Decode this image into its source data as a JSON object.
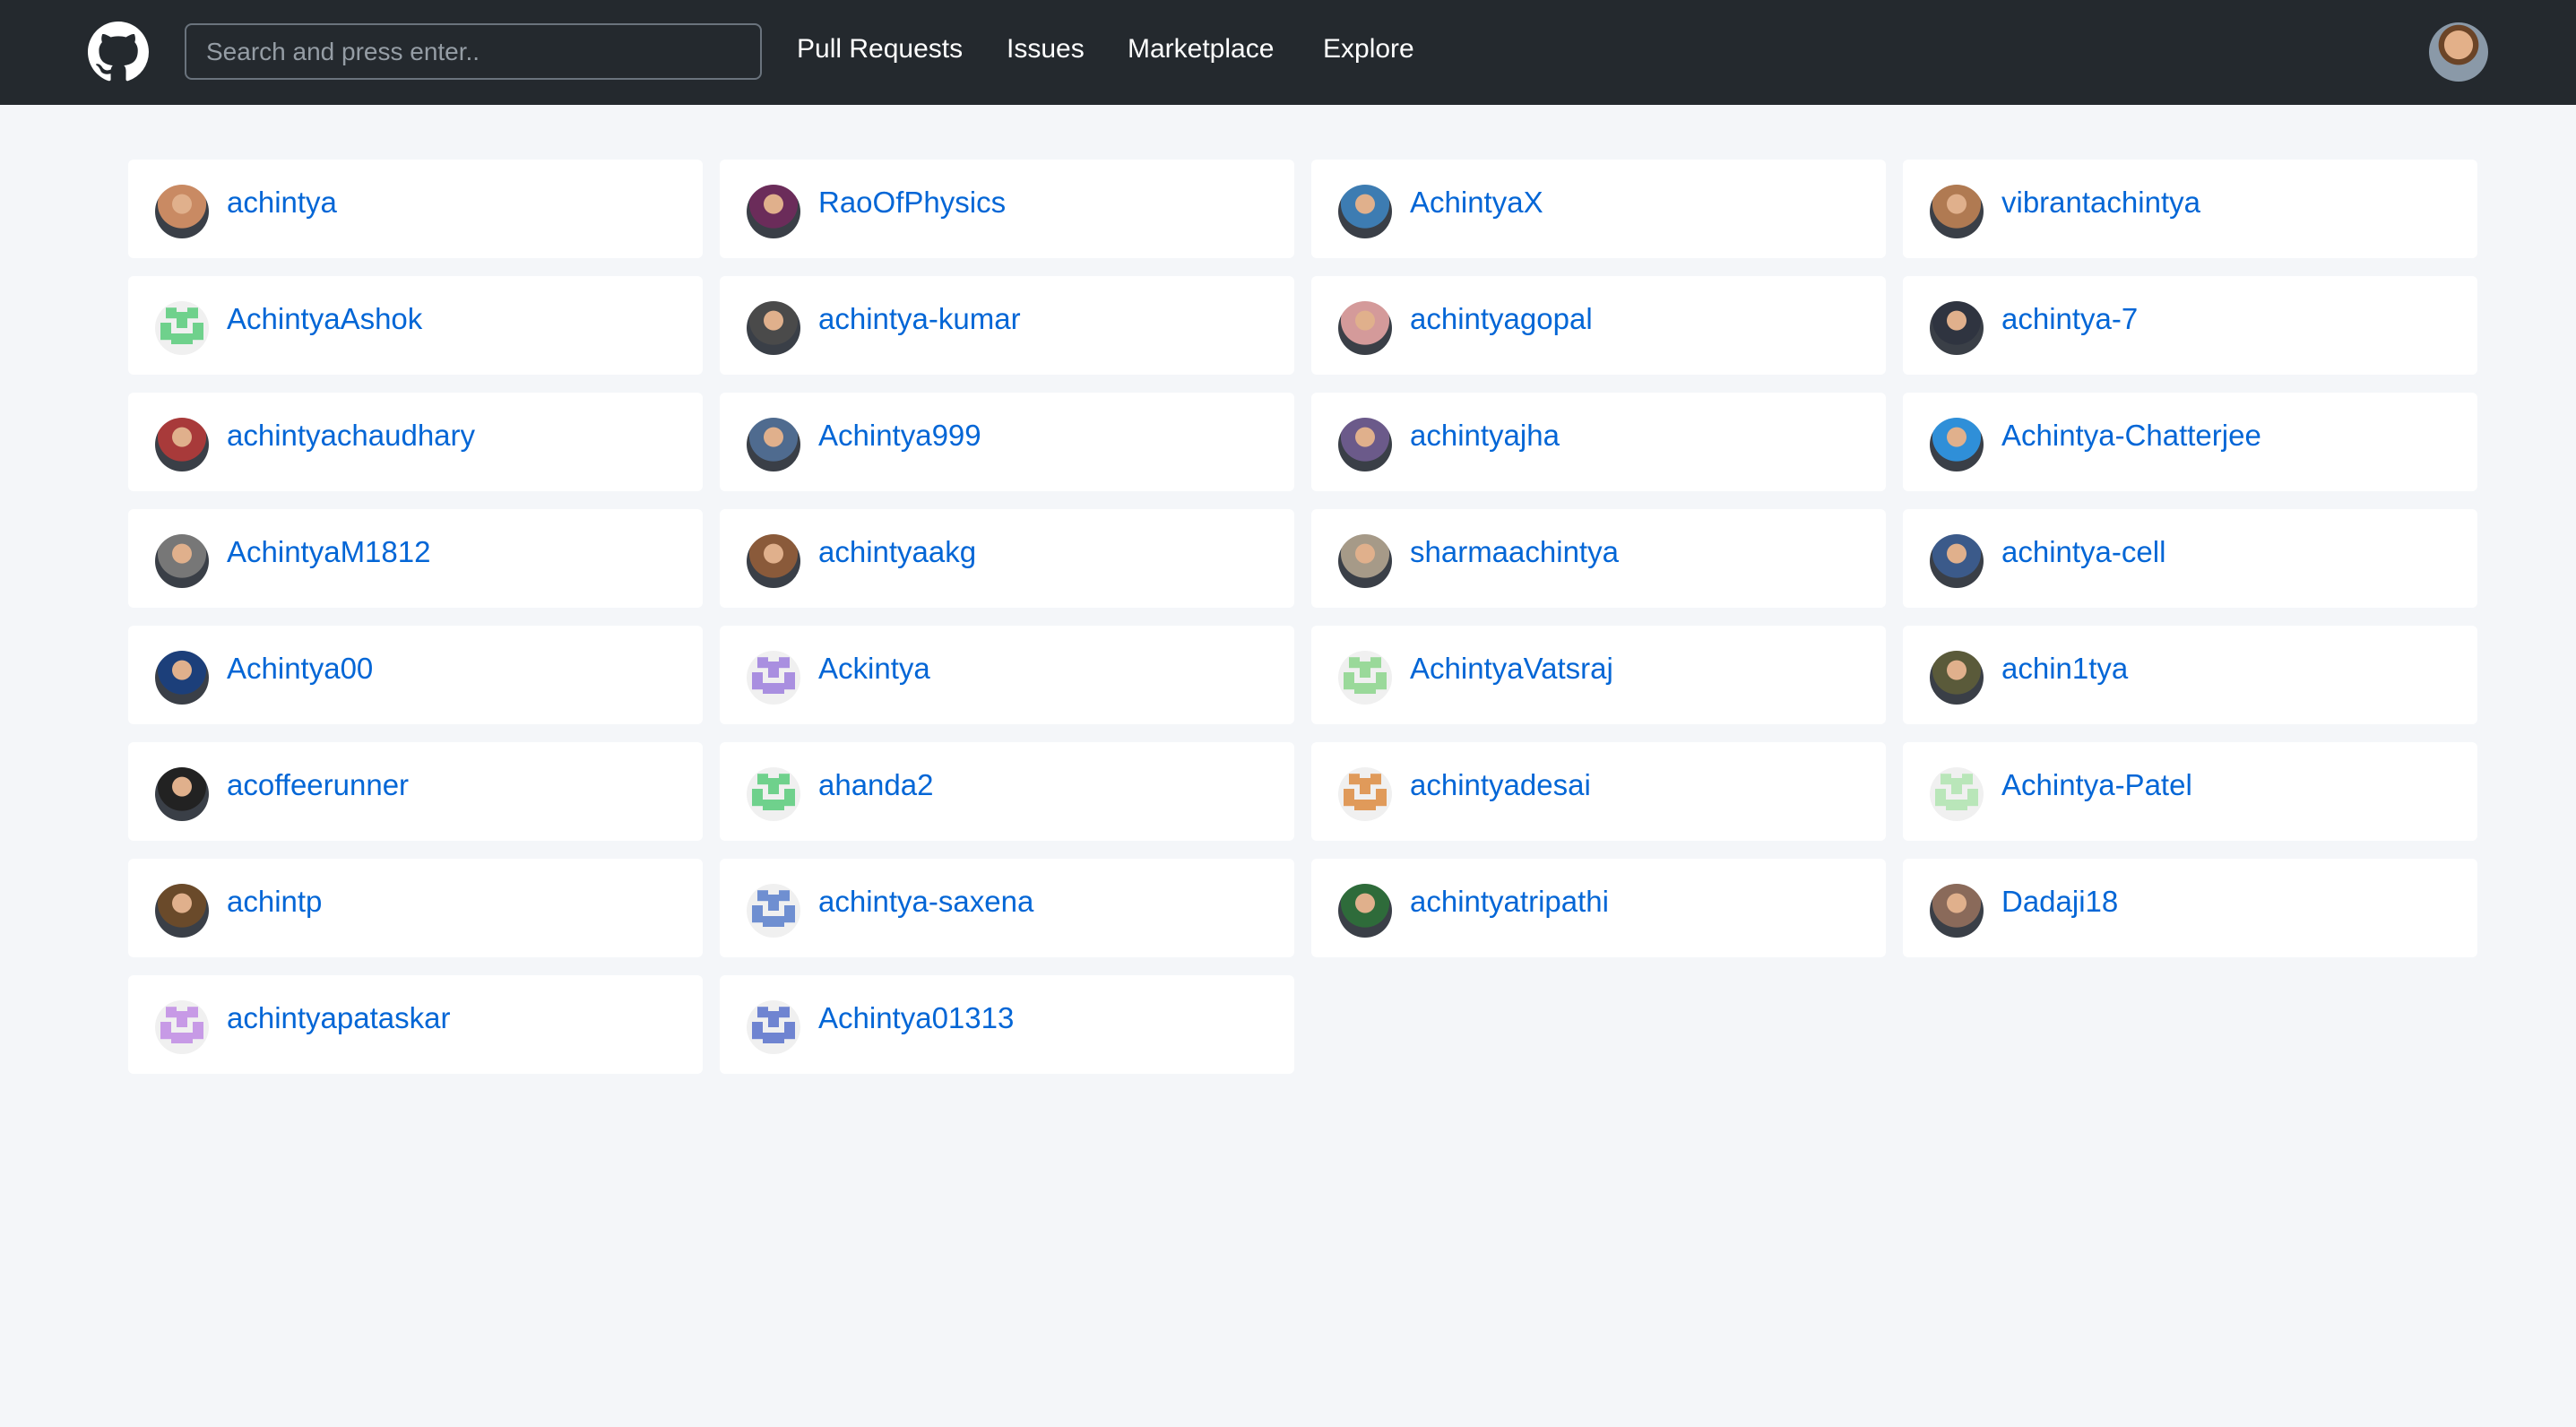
{
  "header": {
    "search_placeholder": "Search and press enter..",
    "nav": [
      "Pull Requests",
      "Issues",
      "Marketplace",
      "Explore"
    ]
  },
  "users": [
    {
      "login": "achintya",
      "avatar": "photo",
      "color": "#c98a63"
    },
    {
      "login": "RaoOfPhysics",
      "avatar": "photo",
      "color": "#6b2c5a"
    },
    {
      "login": "AchintyaX",
      "avatar": "photo",
      "color": "#3d7cb2"
    },
    {
      "login": "vibrantachintya",
      "avatar": "photo",
      "color": "#b07a52"
    },
    {
      "login": "AchintyaAshok",
      "avatar": "identicon",
      "color": "#6fd18c"
    },
    {
      "login": "achintya-kumar",
      "avatar": "photo",
      "color": "#4a4a4a"
    },
    {
      "login": "achintyagopal",
      "avatar": "photo",
      "color": "#d49a9a"
    },
    {
      "login": "achintya-7",
      "avatar": "photo",
      "color": "#2f3440"
    },
    {
      "login": "achintyachaudhary",
      "avatar": "photo",
      "color": "#a83a3a"
    },
    {
      "login": "Achintya999",
      "avatar": "photo",
      "color": "#4f6b8f"
    },
    {
      "login": "achintyajha",
      "avatar": "photo",
      "color": "#6b5a8a"
    },
    {
      "login": "Achintya-Chatterjee",
      "avatar": "photo",
      "color": "#2f8fd8"
    },
    {
      "login": "AchintyaM1812",
      "avatar": "photo",
      "color": "#777777"
    },
    {
      "login": "achintyaakg",
      "avatar": "photo",
      "color": "#8a5a3a"
    },
    {
      "login": "sharmaachintya",
      "avatar": "photo",
      "color": "#a69a88"
    },
    {
      "login": "achintya-cell",
      "avatar": "photo",
      "color": "#3b5a8a"
    },
    {
      "login": "Achintya00",
      "avatar": "photo",
      "color": "#1c3f7a"
    },
    {
      "login": "Ackintya",
      "avatar": "identicon",
      "color": "#a98fe0"
    },
    {
      "login": "AchintyaVatsraj",
      "avatar": "identicon",
      "color": "#9ad99a"
    },
    {
      "login": "achin1tya",
      "avatar": "photo",
      "color": "#5a5a3a"
    },
    {
      "login": "acoffeerunner",
      "avatar": "photo",
      "color": "#222222"
    },
    {
      "login": "ahanda2",
      "avatar": "identicon",
      "color": "#6fd18c"
    },
    {
      "login": "achintyadesai",
      "avatar": "identicon",
      "color": "#e09a5a"
    },
    {
      "login": "Achintya-Patel",
      "avatar": "identicon",
      "color": "#b9e6b9"
    },
    {
      "login": "achintp",
      "avatar": "photo",
      "color": "#6a4a2a"
    },
    {
      "login": "achintya-saxena",
      "avatar": "identicon",
      "color": "#6f8fd1"
    },
    {
      "login": "achintyatripathi",
      "avatar": "photo",
      "color": "#2e6b3a"
    },
    {
      "login": "Dadaji18",
      "avatar": "photo",
      "color": "#8a6a5a"
    },
    {
      "login": "achintyapataskar",
      "avatar": "identicon",
      "color": "#c79ae6"
    },
    {
      "login": "Achintya01313",
      "avatar": "identicon",
      "color": "#6f84d1"
    }
  ]
}
